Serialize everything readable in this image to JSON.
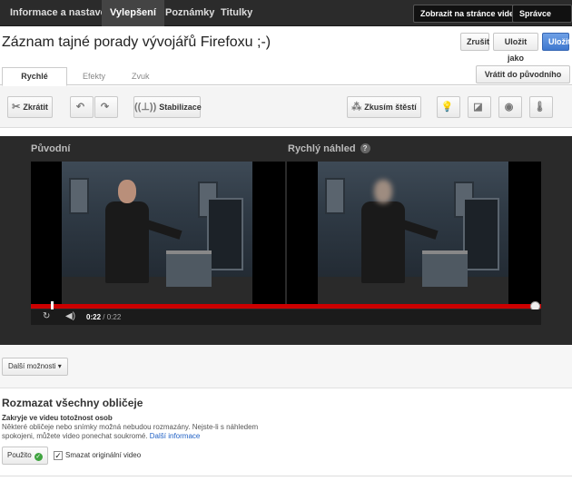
{
  "topnav": {
    "tabs": [
      "Informace a nastavení",
      "Vylepšení",
      "Poznámky",
      "Titulky"
    ],
    "active_tab": "Vylepšení",
    "view_on_page": "Zobrazit na stránce videa",
    "video_manager": "Správce videí"
  },
  "title": "Záznam tajné porady vývojářů Firefoxu ;-)",
  "actions": {
    "cancel": "Zrušit",
    "save_as": "Uložit jako",
    "save": "Uložit",
    "revert": "Vrátit do původního stavu"
  },
  "subtabs": [
    "Rychlé opravy",
    "Efekty",
    "Zvuk"
  ],
  "toolbar": {
    "trim": "Zkrátit",
    "stabilize": "Stabilizace",
    "lucky": "Zkusím štěstí",
    "icons": [
      "scissors-icon",
      "rotate-left-icon",
      "rotate-right-icon",
      "stabilize-icon",
      "magic-icon",
      "lightbulb-icon",
      "contrast-icon",
      "saturation-icon",
      "temperature-icon"
    ]
  },
  "preview": {
    "original_label": "Původní",
    "quick_preview_label": "Rychlý náhled",
    "time_current": "0:22",
    "time_total": "/ 0:22"
  },
  "more_options": "Další možnosti",
  "blur_faces": {
    "title": "Rozmazat všechny obličeje",
    "subtitle": "Zakryje ve videu totožnost osob",
    "text_line1": "Některé obličeje nebo snímky možná nebudou rozmazány. Nejste-li s náhledem",
    "text_line2": "spokojeni, můžete video ponechat soukromé.",
    "link": "Další informace",
    "applied": "Použito",
    "delete_original": "Smazat originální video"
  },
  "colors": {
    "accent": "#cc0000",
    "save_blue": "#3f78cf",
    "link": "#2061c5"
  }
}
